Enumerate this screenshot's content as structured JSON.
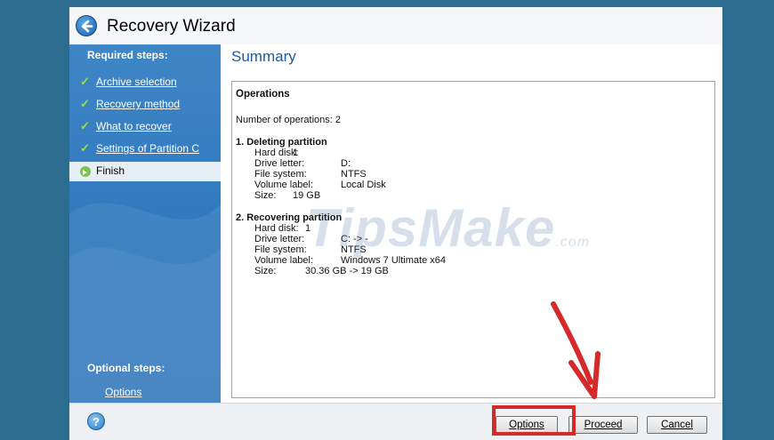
{
  "window": {
    "title": "Recovery Wizard"
  },
  "sidebar": {
    "required_label": "Required steps:",
    "steps": [
      {
        "label": "Archive selection",
        "state": "done"
      },
      {
        "label": "Recovery method",
        "state": "done"
      },
      {
        "label": "What to recover",
        "state": "done"
      },
      {
        "label": "Settings of Partition C",
        "state": "done"
      },
      {
        "label": "Finish",
        "state": "current"
      }
    ],
    "optional_label": "Optional steps:",
    "optional_items": [
      {
        "label": "Options"
      }
    ]
  },
  "content": {
    "title": "Summary",
    "operations_title": "Operations",
    "count_text": "Number of operations: 2",
    "operations": [
      {
        "heading": "1. Deleting partition",
        "fields": [
          {
            "key": "Hard disk:",
            "value": "1"
          },
          {
            "key": "Drive letter:",
            "value": "D:"
          },
          {
            "key": "File system:",
            "value": "NTFS"
          },
          {
            "key": "Volume label:",
            "value": "Local Disk"
          },
          {
            "key": "Size:",
            "value": "19 GB"
          }
        ]
      },
      {
        "heading": "2. Recovering partition",
        "fields": [
          {
            "key": "Hard disk:",
            "value": "1"
          },
          {
            "key": "Drive letter:",
            "value": "C: -> -"
          },
          {
            "key": "File system:",
            "value": "NTFS"
          },
          {
            "key": "Volume label:",
            "value": "Windows 7 Ultimate x64"
          },
          {
            "key": "Size:",
            "value": "30.36 GB -> 19 GB"
          }
        ]
      }
    ],
    "watermark": "TipsMake",
    "watermark_suffix": ".com"
  },
  "footer": {
    "help_glyph": "?",
    "options_label": "Options",
    "proceed_label": "Proceed",
    "cancel_label": "Cancel"
  },
  "colors": {
    "desktop": "#2c6c8e",
    "sidebar": "#2e78bd",
    "title_blue": "#1c5a9a",
    "annotation_red": "#d42a2a"
  }
}
